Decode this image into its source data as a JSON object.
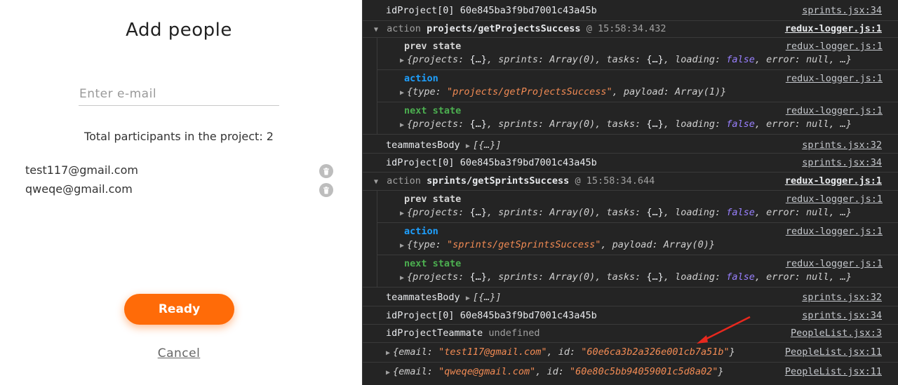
{
  "modal": {
    "title": "Add people",
    "email_placeholder": "Enter e-mail",
    "total_text": "Total participants in the project: 2",
    "participants": [
      "test117@gmail.com",
      "qweqe@gmail.com"
    ],
    "ready_label": "Ready",
    "cancel_label": "Cancel"
  },
  "console": {
    "l1": {
      "label": "idProject[0]",
      "value": "60e845ba3f9bd7001c43a45b",
      "src": "sprints.jsx:34"
    },
    "g1": {
      "prefix": "action",
      "name": "projects/getProjectsSuccess",
      "time": "@ 15:58:34.432",
      "src": "redux-logger.js:1",
      "prev_label": "prev state",
      "prev_src": "redux-logger.js:1",
      "action_label": "action",
      "action_src": "redux-logger.js:1",
      "action_type": "\"projects/getProjectsSuccess\"",
      "action_payload": "Array(1)",
      "next_label": "next state",
      "next_src": "redux-logger.js:1"
    },
    "l2": {
      "label": "teammatesBody",
      "value": "[{…}]",
      "src": "sprints.jsx:32"
    },
    "l3": {
      "label": "idProject[0]",
      "value": "60e845ba3f9bd7001c43a45b",
      "src": "sprints.jsx:34"
    },
    "g2": {
      "prefix": "action",
      "name": "sprints/getSprintsSuccess",
      "time": "@ 15:58:34.644",
      "src": "redux-logger.js:1",
      "prev_label": "prev state",
      "prev_src": "redux-logger.js:1",
      "action_label": "action",
      "action_src": "redux-logger.js:1",
      "action_type": "\"sprints/getSprintsSuccess\"",
      "action_payload": "Array(0)",
      "next_label": "next state",
      "next_src": "redux-logger.js:1"
    },
    "state_summary": {
      "projects": "{…}",
      "sprints": "Array(0)",
      "tasks": "{…}",
      "loading": "false",
      "error": "null"
    },
    "l4": {
      "label": "teammatesBody",
      "value": "[{…}]",
      "src": "sprints.jsx:32"
    },
    "l5": {
      "label": "idProject[0]",
      "value": "60e845ba3f9bd7001c43a45b",
      "src": "sprints.jsx:34"
    },
    "l6": {
      "label": "idProjectTeammate",
      "value": "undefined",
      "src": "PeopleList.jsx:3"
    },
    "o1": {
      "email": "\"test117@gmail.com\"",
      "id": "\"60e6ca3b2a326e001cb7a51b\"",
      "src": "PeopleList.jsx:11"
    },
    "o2": {
      "email": "\"qweqe@gmail.com\"",
      "id": "\"60e80c5bb94059001c5d8a02\"",
      "src": "PeopleList.jsx:11"
    },
    "arrow_color": "#e8281e"
  }
}
